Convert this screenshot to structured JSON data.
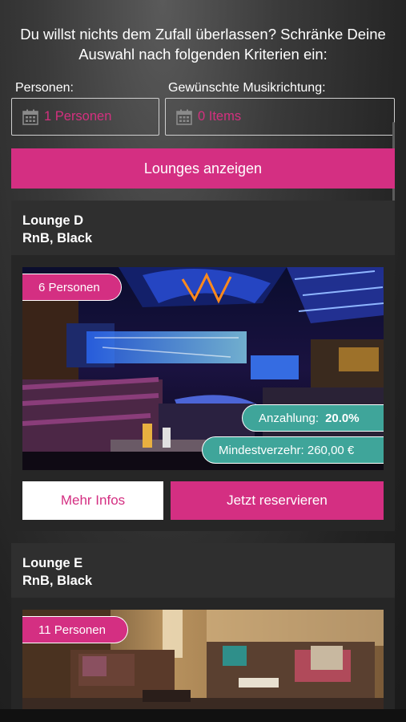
{
  "intro_text": "Du willst nichts dem Zufall überlassen? Schränke Deine Auswahl nach folgenden Kriterien ein:",
  "filters": {
    "persons_label": "Personen:",
    "persons_value": "1 Personen",
    "music_label": "Gewünschte Musikrichtung:",
    "music_value": "0 Items"
  },
  "show_button": "Lounges anzeigen",
  "colors": {
    "accent": "#d42f82",
    "teal": "#3fa59a"
  },
  "lounges": [
    {
      "name": "Lounge D",
      "genres": "RnB, Black",
      "capacity": "6 Personen",
      "deposit_label": "Anzahlung:",
      "deposit_value": "20.0%",
      "minimum_spend": "Mindestverzehr: 260,00 €",
      "more_info": "Mehr Infos",
      "reserve": "Jetzt reservieren"
    },
    {
      "name": "Lounge E",
      "genres": "RnB, Black",
      "capacity": "11 Personen"
    }
  ]
}
